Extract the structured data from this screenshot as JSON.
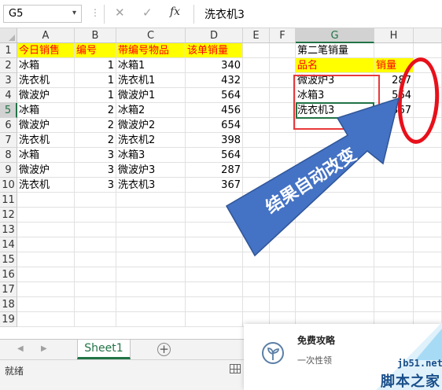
{
  "formula_bar": {
    "name_box": "G5",
    "name_box_arrow": "▾",
    "dots": "⋮",
    "cancel_glyph": "✕",
    "enter_glyph": "✓",
    "fx_glyph": "fx",
    "value": "洗衣机3"
  },
  "grid": {
    "columns": [
      "A",
      "B",
      "C",
      "D",
      "E",
      "F",
      "G",
      "H"
    ],
    "selected_column": "G",
    "rows": [
      "1",
      "2",
      "3",
      "4",
      "5",
      "6",
      "7",
      "8",
      "9",
      "10",
      "11",
      "12",
      "13",
      "14",
      "15",
      "16",
      "17",
      "18",
      "19"
    ],
    "selected_row": "5",
    "cells": {
      "A1": "今日销售",
      "B1": "编号",
      "C1": "带编号物品",
      "D1": "该单销量",
      "A2": "冰箱",
      "B2": "1",
      "C2": "冰箱1",
      "D2": "340",
      "A3": "洗衣机",
      "B3": "1",
      "C3": "洗衣机1",
      "D3": "432",
      "A4": "微波炉",
      "B4": "1",
      "C4": "微波炉1",
      "D4": "564",
      "A5": "冰箱",
      "B5": "2",
      "C5": "冰箱2",
      "D5": "456",
      "A6": "微波炉",
      "B6": "2",
      "C6": "微波炉2",
      "D6": "654",
      "A7": "洗衣机",
      "B7": "2",
      "C7": "洗衣机2",
      "D7": "398",
      "A8": "冰箱",
      "B8": "3",
      "C8": "冰箱3",
      "D8": "564",
      "A9": "微波炉",
      "B9": "3",
      "C9": "微波炉3",
      "D9": "287",
      "A10": "洗衣机",
      "B10": "3",
      "C10": "洗衣机3",
      "D10": "367",
      "G1": "第二笔销量",
      "G2": "品名",
      "H2": "销量",
      "G3": "微波炉3",
      "H3": "287",
      "G4": "冰箱3",
      "H4": "564",
      "G5": "洗衣机3",
      "H5": "367"
    }
  },
  "annotation": {
    "arrow_text": "结果自动改变",
    "arrow_color": "#4472c4",
    "highlight_color": "#e8101a"
  },
  "sheet_tabs": {
    "nav_prev": "◀",
    "nav_next": "▶",
    "tabs": [
      "Sheet1"
    ],
    "add": "+"
  },
  "status_bar": {
    "text": "就绪"
  },
  "popup": {
    "title": "免费攻略",
    "subtitle": "一次性领"
  },
  "watermark": {
    "url": "jb51.net",
    "brand": "脚本之家"
  },
  "colors": {
    "excel_green": "#217346",
    "header_yellow": "#ffff00",
    "header_red_text": "#ff0000"
  }
}
